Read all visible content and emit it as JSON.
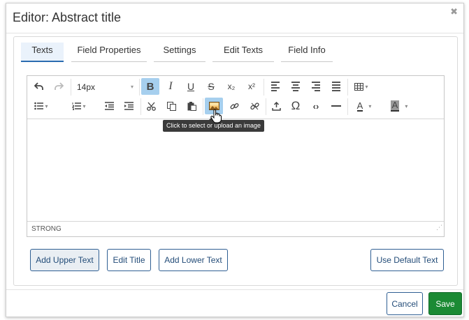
{
  "dialog": {
    "title": "Editor: Abstract title",
    "close_icon": "close-icon"
  },
  "tabs": [
    {
      "label": "Texts",
      "active": true
    },
    {
      "label": "Field Properties",
      "active": false
    },
    {
      "label": "Settings",
      "active": false
    },
    {
      "label": "Edit Texts",
      "active": false
    },
    {
      "label": "Field Info",
      "active": false
    }
  ],
  "toolbar": {
    "font_size": "14px",
    "bold_label": "B",
    "italic_label": "I",
    "underline_label": "U",
    "strike_label": "S",
    "subscript_label": "x₂",
    "superscript_label": "x²",
    "special_char_label": "Ω",
    "code_label": "‹›",
    "text_color_label": "A",
    "bg_color_label": "A",
    "active_button": "insert-image-button",
    "highlight_color": "#a6cfee"
  },
  "tooltip": "Click to select or upload an image",
  "statusbar": "STRONG",
  "buttons": {
    "add_upper_text": "Add Upper Text",
    "edit_title": "Edit Title",
    "add_lower_text": "Add Lower Text",
    "use_default_text": "Use Default Text"
  },
  "footer": {
    "cancel": "Cancel",
    "save": "Save",
    "save_color": "#1b8a34"
  }
}
